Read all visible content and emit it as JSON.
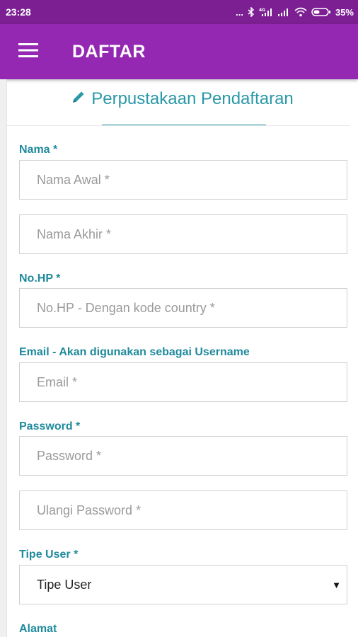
{
  "status_bar": {
    "time": "23:28",
    "dots": "...",
    "network": "4G",
    "battery": "35%",
    "icons": [
      "bluetooth-icon",
      "signal-icon",
      "signal-icon",
      "wifi-icon",
      "battery-icon"
    ]
  },
  "app_bar": {
    "title": "DAFTAR",
    "menu_icon": "hamburger-menu-icon",
    "color": "#9428b3"
  },
  "form": {
    "title": "Perpustakaan Pendaftaran",
    "title_icon": "pencil-icon",
    "accent": "#2a98a8",
    "name_label": "Nama *",
    "first_name_placeholder": "Nama Awal *",
    "last_name_placeholder": "Nama Akhir *",
    "phone_label": "No.HP *",
    "phone_placeholder": "No.HP - Dengan kode country *",
    "email_label": "Email - Akan digunakan sebagai Username",
    "email_placeholder": "Email *",
    "password_label": "Password *",
    "password_placeholder": "Password *",
    "password_repeat_placeholder": "Ulangi Password *",
    "user_type_label": "Tipe User *",
    "user_type_selected": "Tipe User",
    "address_label": "Alamat"
  }
}
